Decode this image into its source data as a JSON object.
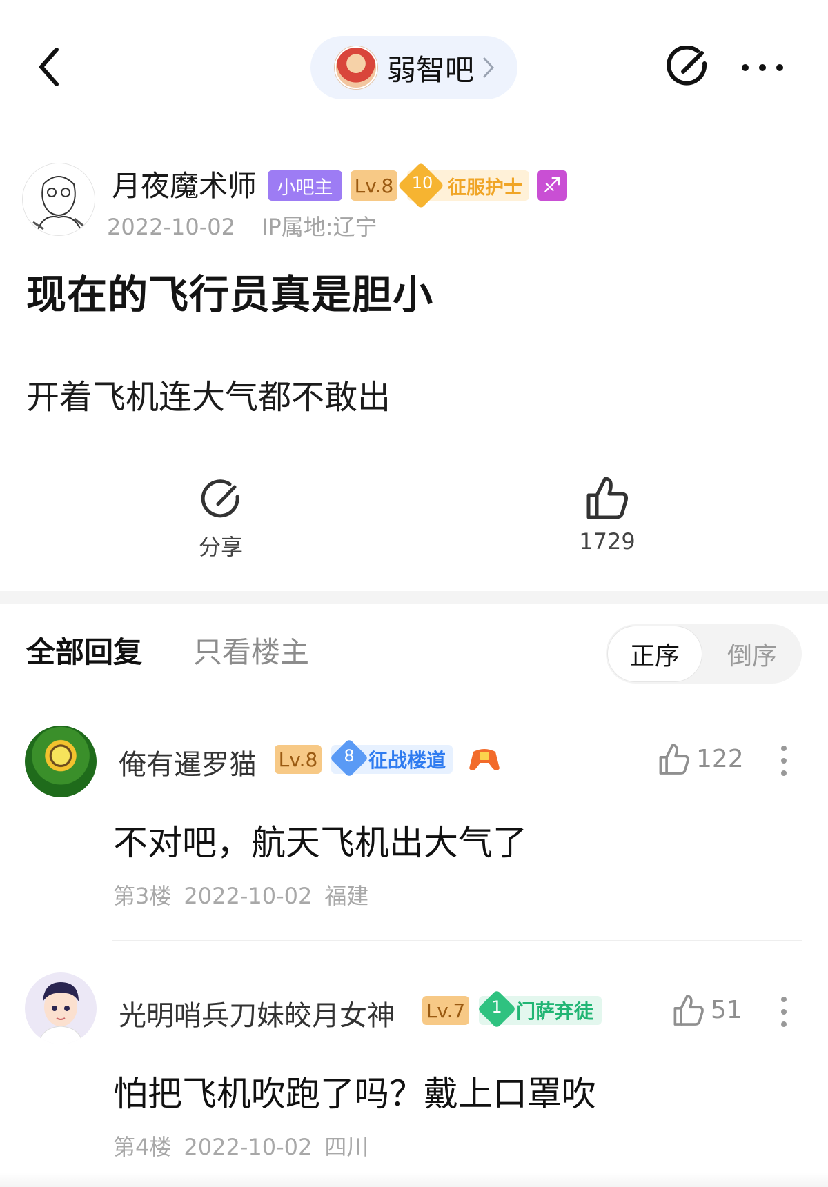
{
  "forum": {
    "name": "弱智吧"
  },
  "post": {
    "author": {
      "name": "月夜魔术师",
      "role_badge": "小吧主",
      "level": "Lv.8",
      "conquer_level": "10",
      "conquer_title": "征服护士",
      "zodiac_badge": "♐"
    },
    "date": "2022-10-02",
    "ip_location": "IP属地:辽宁",
    "title": "现在的飞行员真是胆小",
    "body": "开着飞机连大气都不敢出",
    "share_label": "分享",
    "like_count": "1729"
  },
  "reply_tabs": {
    "all": "全部回复",
    "owner_only": "只看楼主"
  },
  "sort": {
    "asc": "正序",
    "desc": "倒序"
  },
  "comments": [
    {
      "user": "俺有暹罗猫",
      "level": "Lv.8",
      "badge_level": "8",
      "badge_title": "征战楼道",
      "text": "不对吧，航天飞机出大气了",
      "floor": "第3楼",
      "date": "2022-10-02",
      "location": "福建",
      "likes": "122"
    },
    {
      "user": "光明哨兵刀妹皎月女神",
      "level": "Lv.7",
      "badge_level": "1",
      "badge_title": "门萨弃徒",
      "text": "怕把飞机吹跑了吗？戴上口罩吹",
      "floor": "第4楼",
      "date": "2022-10-02",
      "location": "四川",
      "likes": "51"
    }
  ],
  "colors": {
    "owner_badge": "#9d7cf4",
    "level_badge": "#f7c986",
    "conquer_badge": "#f6b431",
    "blue_badge": "#5a9af5",
    "green_badge": "#2fc280",
    "pill_bg": "#eef3fd"
  },
  "icons": [
    "back-arrow-icon",
    "chevron-right-icon",
    "share-icon",
    "more-icon",
    "thumbs-up-icon",
    "vertical-more-icon",
    "game-controller-icon"
  ]
}
